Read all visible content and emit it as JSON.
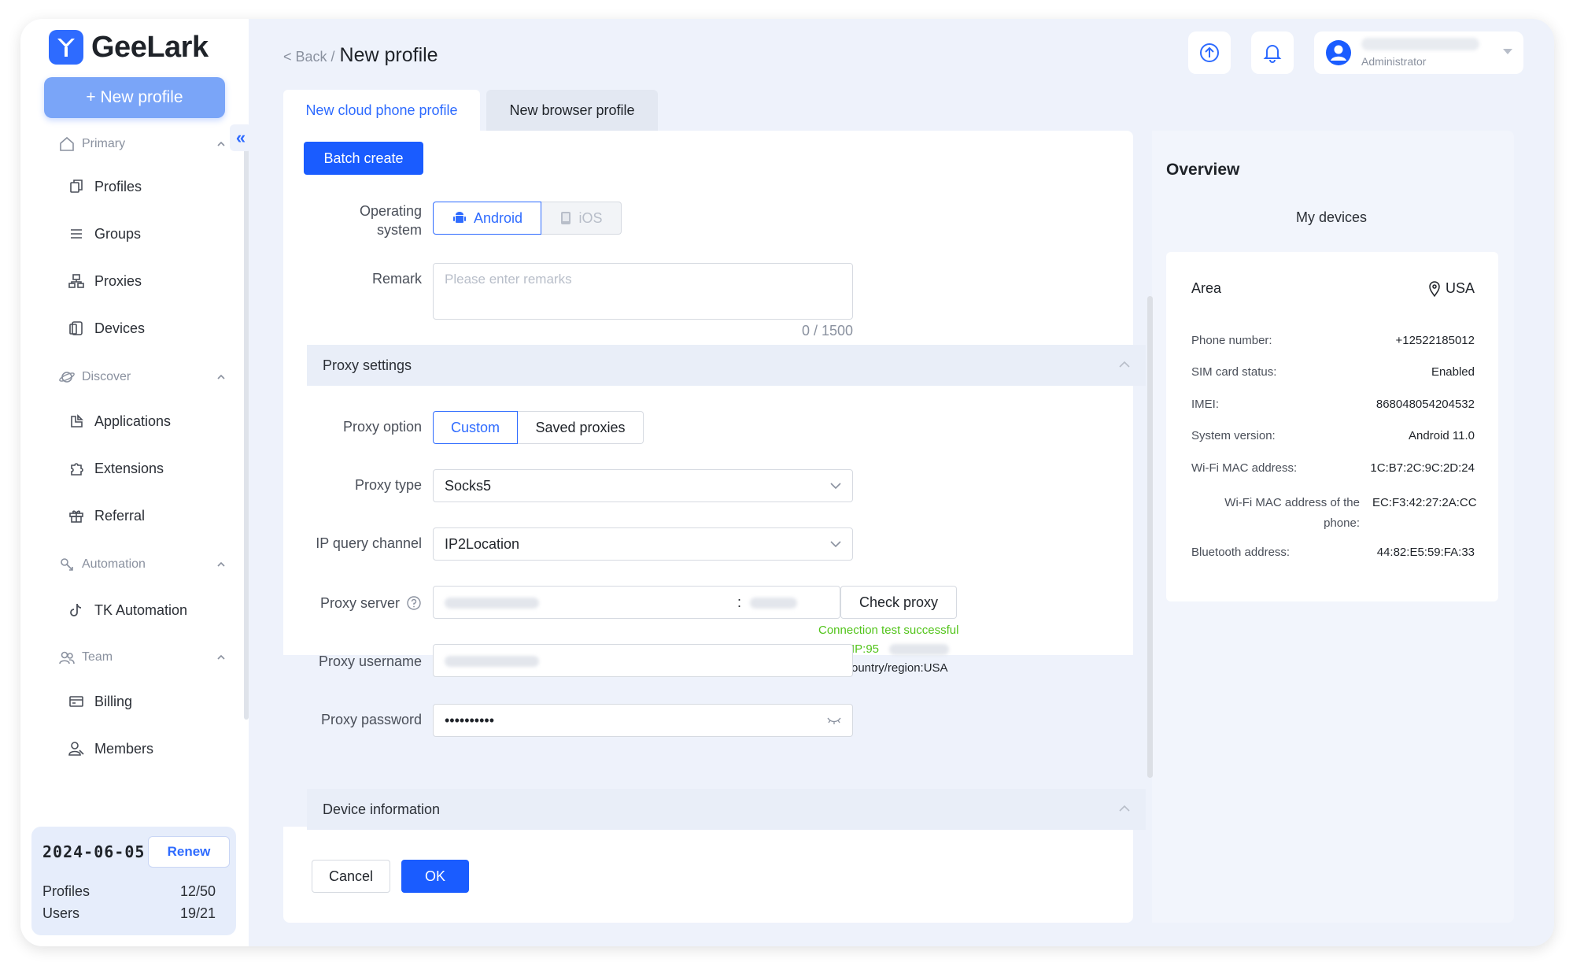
{
  "brand": {
    "name": "GeeLark",
    "accent": "#2e6bff",
    "primary_button": "#1a5cff"
  },
  "sidebar": {
    "new_profile_label": "+ New profile",
    "groups": [
      {
        "label": "Primary",
        "icon": "home-icon",
        "items": [
          {
            "label": "Profiles",
            "icon": "profiles-icon"
          },
          {
            "label": "Groups",
            "icon": "list-icon"
          },
          {
            "label": "Proxies",
            "icon": "network-icon"
          },
          {
            "label": "Devices",
            "icon": "devices-icon"
          }
        ]
      },
      {
        "label": "Discover",
        "icon": "planet-icon",
        "items": [
          {
            "label": "Applications",
            "icon": "applications-icon"
          },
          {
            "label": "Extensions",
            "icon": "puzzle-icon"
          },
          {
            "label": "Referral",
            "icon": "gift-icon"
          }
        ]
      },
      {
        "label": "Automation",
        "icon": "automation-icon",
        "items": [
          {
            "label": "TK Automation",
            "icon": "tiktok-icon"
          }
        ]
      },
      {
        "label": "Team",
        "icon": "team-icon",
        "items": [
          {
            "label": "Billing",
            "icon": "billing-icon"
          },
          {
            "label": "Members",
            "icon": "members-icon"
          }
        ]
      }
    ],
    "plan": {
      "date": "2024-06-05",
      "renew_label": "Renew",
      "profiles_label": "Profiles",
      "profiles_value": "12/50",
      "users_label": "Users",
      "users_value": "19/21"
    }
  },
  "header": {
    "back_label": "< Back /",
    "title": "New profile",
    "user_role": "Administrator"
  },
  "tabs": [
    {
      "label": "New cloud phone profile",
      "active": true
    },
    {
      "label": "New browser profile",
      "active": false
    }
  ],
  "form": {
    "batch_create_label": "Batch create",
    "os_label_line1": "Operating",
    "os_label_line2": "system",
    "os_options": [
      {
        "label": "Android",
        "selected": true
      },
      {
        "label": "iOS",
        "disabled": true
      }
    ],
    "remark_label": "Remark",
    "remark_placeholder": "Please enter remarks",
    "remark_counter": "0 / 1500",
    "proxy_section_title": "Proxy settings",
    "proxy_option_label": "Proxy option",
    "proxy_options": [
      {
        "label": "Custom",
        "selected": true
      },
      {
        "label": "Saved proxies",
        "selected": false
      }
    ],
    "proxy_type_label": "Proxy type",
    "proxy_type_value": "Socks5",
    "ip_query_label": "IP query channel",
    "ip_query_value": "IP2Location",
    "proxy_server_label": "Proxy server",
    "proxy_server_separator": ":",
    "check_proxy_label": "Check proxy",
    "connection_status": "Connection test successful",
    "ip_prefix": "IP:95",
    "country_text": "ountry/region:USA",
    "proxy_username_label": "Proxy username",
    "proxy_password_label": "Proxy password",
    "proxy_password_value": "••••••••••",
    "device_section_title": "Device information",
    "cancel_label": "Cancel",
    "ok_label": "OK"
  },
  "overview": {
    "title": "Overview",
    "subtitle": "My devices",
    "area_label": "Area",
    "area_value": "USA",
    "rows": [
      {
        "key": "Phone number:",
        "value": "+12522185012"
      },
      {
        "key": "SIM card status:",
        "value": "Enabled"
      },
      {
        "key": "IMEI:",
        "value": "868048054204532"
      },
      {
        "key": "System version:",
        "value": "Android 11.0"
      },
      {
        "key": "Wi-Fi MAC address:",
        "value": "1C:B7:2C:9C:2D:24"
      },
      {
        "key": "Wi-Fi MAC address of the phone:",
        "value": "EC:F3:42:27:2A:CC"
      },
      {
        "key": "Bluetooth address:",
        "value": "44:82:E5:59:FA:33"
      }
    ]
  }
}
